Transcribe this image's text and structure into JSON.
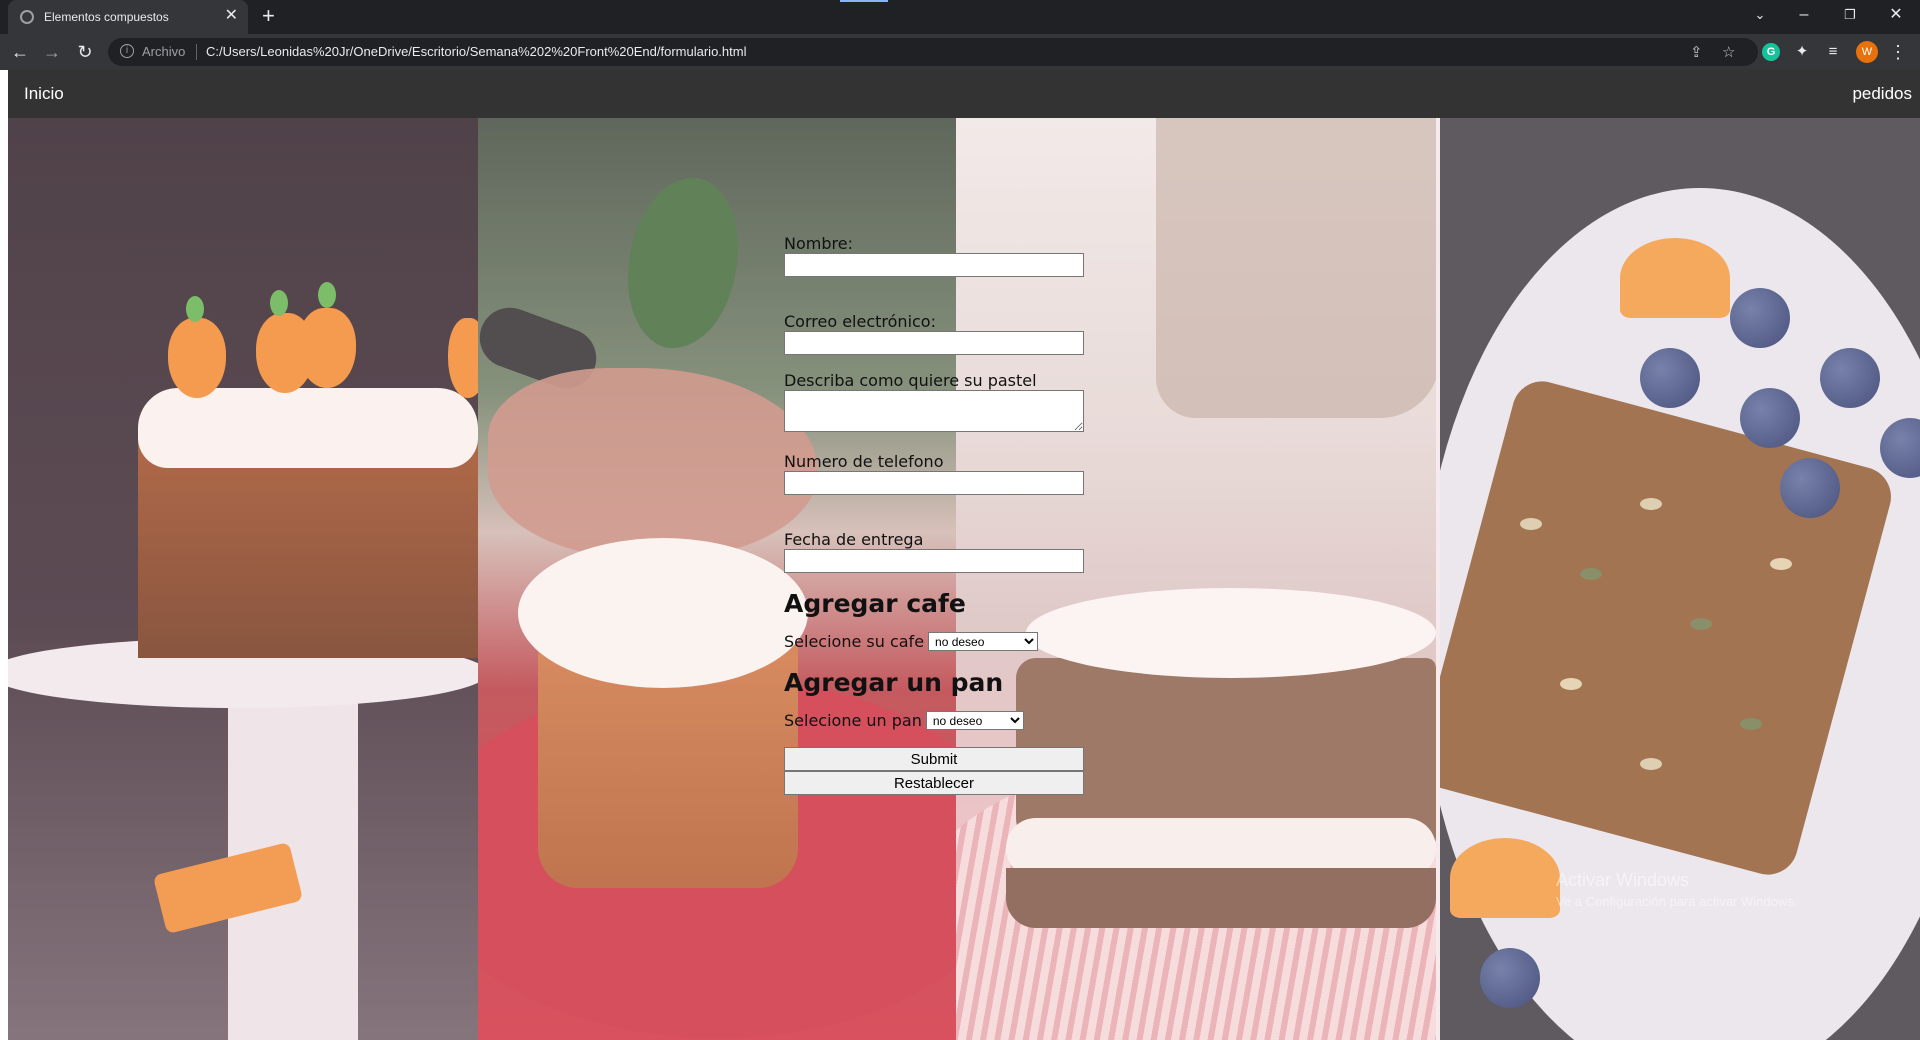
{
  "browser": {
    "tab_title": "Elementos compuestos",
    "tab_close": "✕",
    "new_tab": "+",
    "scheme_label": "Archivo",
    "url": "C:/Users/Leonidas%20Jr/OneDrive/Escritorio/Semana%202%20Front%20End/formulario.html",
    "avatar_letter": "W",
    "extension_letter": "G"
  },
  "nav": {
    "home": "Inicio",
    "orders": "pedidos"
  },
  "form": {
    "name_label": "Nombre:",
    "email_label": "Correo electrónico:",
    "cake_desc_label": "Describa como quiere su pastel",
    "phone_label": "Numero de telefono",
    "date_label": "Fecha de entrega",
    "coffee_heading": "Agregar cafe",
    "coffee_label": "Selecione su cafe",
    "coffee_selected": "no deseo",
    "bread_heading": "Agregar un pan",
    "bread_label": "Selecione un pan",
    "bread_selected": "no deseo",
    "submit_label": "Submit",
    "reset_label": "Restablecer"
  },
  "watermark": {
    "title": "Activar Windows",
    "subtitle": "Ve a Configuración para activar Windows."
  },
  "colors": {
    "navbar": "#333333",
    "chrome_dark": "#202124",
    "chrome_toolbar": "#35363a",
    "avatar": "#e8710a"
  },
  "icons": [
    "back-icon",
    "forward-icon",
    "reload-icon",
    "info-icon",
    "share-icon",
    "star-icon",
    "extensions-icon",
    "reading-list-icon",
    "menu-icon",
    "minimize-icon",
    "restore-icon",
    "close-window-icon",
    "tab-search-icon"
  ]
}
